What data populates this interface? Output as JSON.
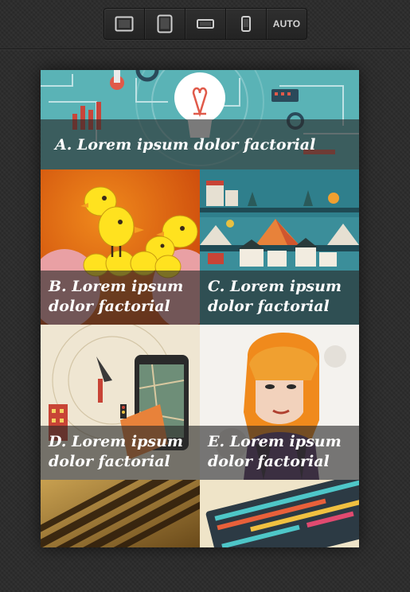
{
  "toolbar": {
    "buttons": [
      {
        "name": "desktop-view-button",
        "icon": "desktop-icon"
      },
      {
        "name": "tablet-view-button",
        "icon": "tablet-icon"
      },
      {
        "name": "tablet-landscape-view-button",
        "icon": "tablet-landscape-icon"
      },
      {
        "name": "phone-view-button",
        "icon": "phone-icon"
      }
    ],
    "auto_label": "AUTO"
  },
  "gallery": {
    "items": [
      {
        "caption": "A. Lorem ipsum dolor factorial",
        "image": "lightbulb-infographic-illustration"
      },
      {
        "caption": "B. Lorem ipsum dolor factorial",
        "image": "yellow-chicks-illustration"
      },
      {
        "caption": "C. Lorem ipsum dolor factorial",
        "image": "village-landscape-illustration"
      },
      {
        "caption": "D. Lorem ipsum dolor factorial",
        "image": "smartphone-map-illustration"
      },
      {
        "caption": "E. Lorem ipsum dolor factorial",
        "image": "orange-hair-portrait-illustration"
      },
      {
        "caption": "",
        "image": "typography-poster-photo"
      },
      {
        "caption": "",
        "image": "abstract-stripes-illustration"
      }
    ]
  },
  "colors": {
    "background": "#2b2b2b",
    "caption_overlay": "rgba(40,40,40,0.62)",
    "teal": "#5ab3b6",
    "orange": "#e8640f"
  }
}
